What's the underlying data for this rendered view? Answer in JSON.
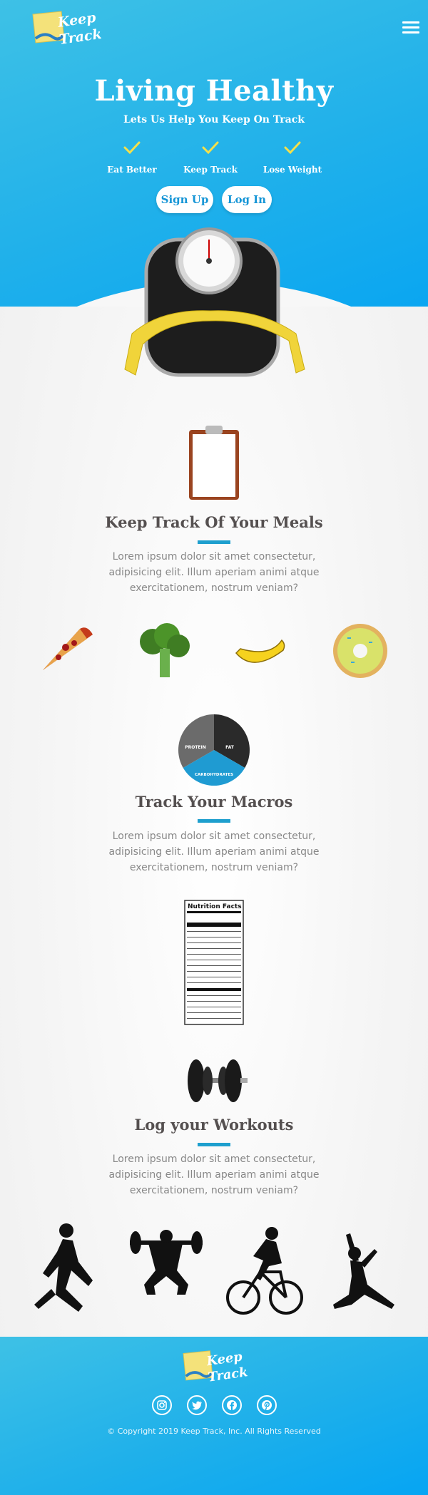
{
  "brand": {
    "logo_line1": "Keep",
    "logo_line2": "Track"
  },
  "hero": {
    "title": "Living Healthy",
    "subtitle": "Lets Us Help You Keep On Track",
    "features": [
      {
        "label": "Eat Better",
        "icon": "check-icon"
      },
      {
        "label": "Keep Track",
        "icon": "check-icon"
      },
      {
        "label": "Lose Weight",
        "icon": "check-icon"
      }
    ],
    "buttons": {
      "signup": "Sign Up",
      "login": "Log In"
    }
  },
  "sections": [
    {
      "title": "Keep Track Of Your Meals",
      "text": "Lorem ipsum dolor sit amet consectetur, adipisicing elit. Illum aperiam animi atque exercitationem, nostrum veniam?"
    },
    {
      "title": "Track Your Macros",
      "text": "Lorem ipsum dolor sit amet consectetur, adipisicing elit. Illum aperiam animi atque exercitationem, nostrum veniam?"
    },
    {
      "title": "Log your Workouts",
      "text": "Lorem ipsum dolor sit amet consectetur, adipisicing elit. Illum aperiam animi atque exercitationem, nostrum veniam?"
    }
  ],
  "macros_chart": {
    "labels": [
      "PROTEIN",
      "FAT",
      "CARBOHYDRATES"
    ]
  },
  "nutrition_label": {
    "title": "Nutrition Facts"
  },
  "foods": [
    "pizza-icon",
    "broccoli-icon",
    "banana-icon",
    "donut-icon"
  ],
  "workouts": [
    "runner-icon",
    "weightlifter-icon",
    "cyclist-icon",
    "yoga-icon"
  ],
  "footer": {
    "social": [
      "instagram-icon",
      "twitter-icon",
      "facebook-icon",
      "pinterest-icon"
    ],
    "copyright": "© Copyright 2019 Keep Track, Inc. All Rights Reserved"
  },
  "colors": {
    "primary": "#21b1ea",
    "accent_bar": "#1e9fce",
    "check": "#f5e04a",
    "text_dark": "#555050"
  }
}
